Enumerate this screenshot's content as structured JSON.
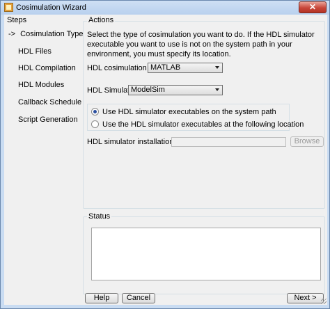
{
  "window": {
    "title": "Cosimulation Wizard",
    "close_glyph": "✕"
  },
  "steps": {
    "header": "Steps",
    "active_marker": "->",
    "items": [
      {
        "label": "Cosimulation Type",
        "active": true
      },
      {
        "label": "HDL Files"
      },
      {
        "label": "HDL Compilation"
      },
      {
        "label": "HDL Modules"
      },
      {
        "label": "Callback Schedule"
      },
      {
        "label": "Script Generation"
      }
    ]
  },
  "actions": {
    "legend": "Actions",
    "description": "Select the type of cosimulation you want to do. If the HDL simulator executable you want to use is not on the system path in your environment, you must specify its location.",
    "cosim_label": "HDL cosimulation with:",
    "cosim_value": "MATLAB",
    "simulator_label": "HDL Simulator:",
    "simulator_value": "ModelSim",
    "radio_system_path": "Use HDL simulator executables on the system path",
    "radio_location": "Use the HDL simulator executables at the following location",
    "install_path_label": "HDL simulator installation path:",
    "install_path_value": "",
    "browse_label": "Browse"
  },
  "status": {
    "legend": "Status",
    "text": ""
  },
  "footer": {
    "help_label": "Help",
    "cancel_label": "Cancel",
    "next_label": "Next >"
  }
}
